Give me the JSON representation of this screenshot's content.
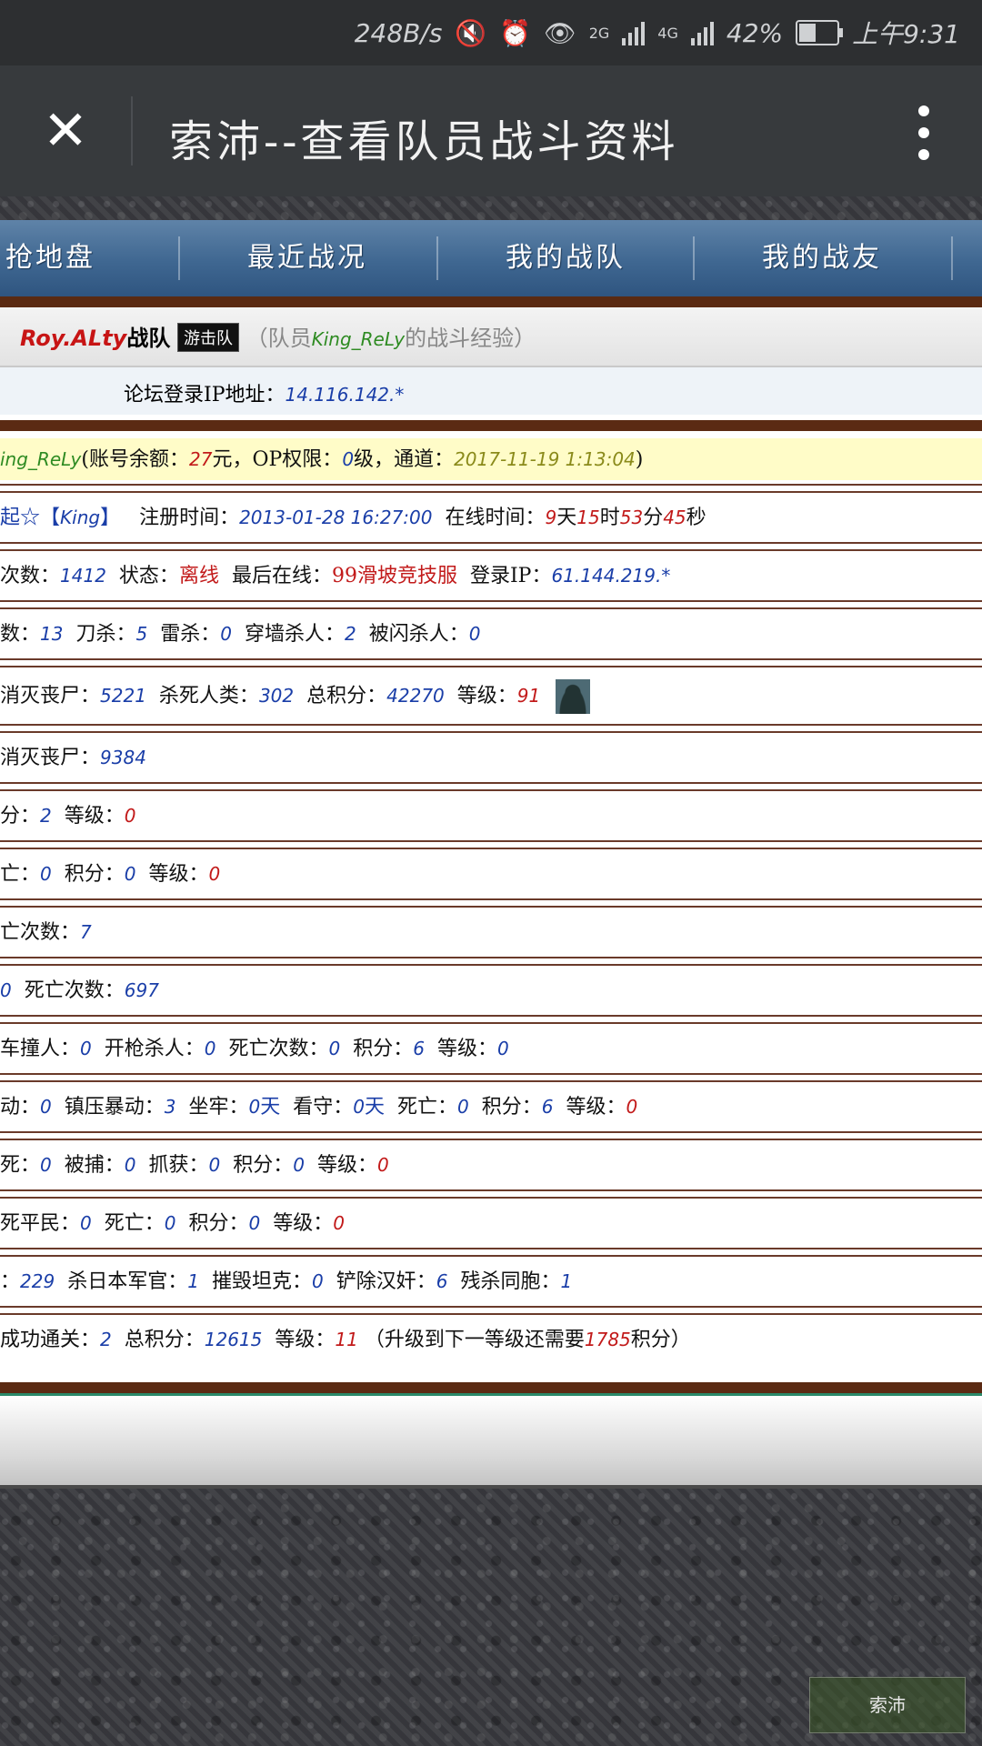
{
  "status_bar": {
    "net_speed": "248B/s",
    "net_2g": "2G",
    "net_4g": "4G",
    "battery": "42%",
    "time": "上午9:31"
  },
  "header": {
    "title": "索沛--查看队员战斗资料"
  },
  "nav": {
    "items": [
      "抢地盘",
      "最近战况",
      "我的战队",
      "我的战友"
    ]
  },
  "team": {
    "name": "Roy.ALty",
    "suffix": "战队",
    "badge": "游击队",
    "desc_prefix": "（队员",
    "member": "King_ReLy",
    "desc_suffix": "的战斗经验）"
  },
  "forum_ip": {
    "label": "论坛登录IP地址：",
    "value": "14.116.142.*"
  },
  "account": {
    "name_fragment": "ing_ReLy",
    "balance_label": "(账号余额：",
    "balance": "27",
    "balance_unit": "元，",
    "op_label": "OP权限：",
    "op_level": "0",
    "op_unit": "级，",
    "channel_label": "通道：",
    "channel_time": "2017-11-19 1:13:04",
    "close": ")"
  },
  "rows": {
    "r2": {
      "a": "起☆【",
      "b": "King",
      "c": "】",
      "reg_label": "注册时间：",
      "reg_time": "2013-01-28 16:27:00",
      "online_label": "在线时间：",
      "d": "9",
      "d_u": "天",
      "h": "15",
      "h_u": "时",
      "m": "53",
      "m_u": "分",
      "s": "45",
      "s_u": "秒"
    },
    "r3": {
      "a": "次数：",
      "count": "1412",
      "state_label": "状态：",
      "state": "离线",
      "last_label": "最后在线：",
      "last": "99滑坡竞技服",
      "ip_label": "登录IP：",
      "ip": "61.144.219.*"
    },
    "r4": {
      "a": "数：",
      "v1": "13",
      "b": "刀杀：",
      "v2": "5",
      "c": "雷杀：",
      "v3": "0",
      "d": "穿墙杀人：",
      "v4": "2",
      "e": "被闪杀人：",
      "v5": "0"
    },
    "r5": {
      "a": "消灭丧尸：",
      "v1": "5221",
      "b": "杀死人类：",
      "v2": "302",
      "c": "总积分：",
      "v3": "42270",
      "d": "等级：",
      "v4": "91"
    },
    "r6": {
      "a": "消灭丧尸：",
      "v1": "9384"
    },
    "r7": {
      "a": "分：",
      "v1": "2",
      "b": "等级：",
      "v2": "0"
    },
    "r8": {
      "a": "亡：",
      "v1": "0",
      "b": "积分：",
      "v2": "0",
      "c": "等级：",
      "v3": "0"
    },
    "r9": {
      "a": "亡次数：",
      "v1": "7"
    },
    "r10": {
      "a": "0",
      "b": "死亡次数：",
      "v1": "697"
    },
    "r11": {
      "a": "车撞人：",
      "v1": "0",
      "b": "开枪杀人：",
      "v2": "0",
      "c": "死亡次数：",
      "v3": "0",
      "d": "积分：",
      "v4": "6",
      "e": "等级：",
      "v5": "0"
    },
    "r12": {
      "a": "动：",
      "v1": "0",
      "b": "镇压暴动：",
      "v2": "3",
      "c": "坐牢：",
      "v3": "0",
      "v3u": "天",
      "d": "看守：",
      "v4": "0",
      "v4u": "天",
      "e": "死亡：",
      "v5": "0",
      "f": "积分：",
      "v6": "6",
      "g": "等级：",
      "v7": "0"
    },
    "r13": {
      "a": "死：",
      "v1": "0",
      "b": "被捕：",
      "v2": "0",
      "c": "抓获：",
      "v3": "0",
      "d": "积分：",
      "v4": "0",
      "e": "等级：",
      "v5": "0"
    },
    "r14": {
      "a": "死平民：",
      "v1": "0",
      "b": "死亡：",
      "v2": "0",
      "c": "积分：",
      "v3": "0",
      "d": "等级：",
      "v4": "0"
    },
    "r15": {
      "a": "：",
      "v1": "229",
      "b": "杀日本军官：",
      "v2": "1",
      "c": "摧毁坦克：",
      "v3": "0",
      "d": "铲除汉奸：",
      "v4": "6",
      "e": "残杀同胞：",
      "v5": "1"
    },
    "r16": {
      "a": "成功通关：",
      "v1": "2",
      "b": "总积分：",
      "v2": "12615",
      "c": "等级：",
      "v3": "11",
      "d": "（升级到下一等级还需要",
      "v4": "1785",
      "e": "积分）"
    }
  },
  "icons": {
    "close": "close-icon",
    "more": "more-vertical-icon",
    "mute": "mute-icon",
    "alarm": "alarm-icon",
    "eye": "eye-icon",
    "avatar": "avatar-image"
  },
  "watermark": "索沛"
}
